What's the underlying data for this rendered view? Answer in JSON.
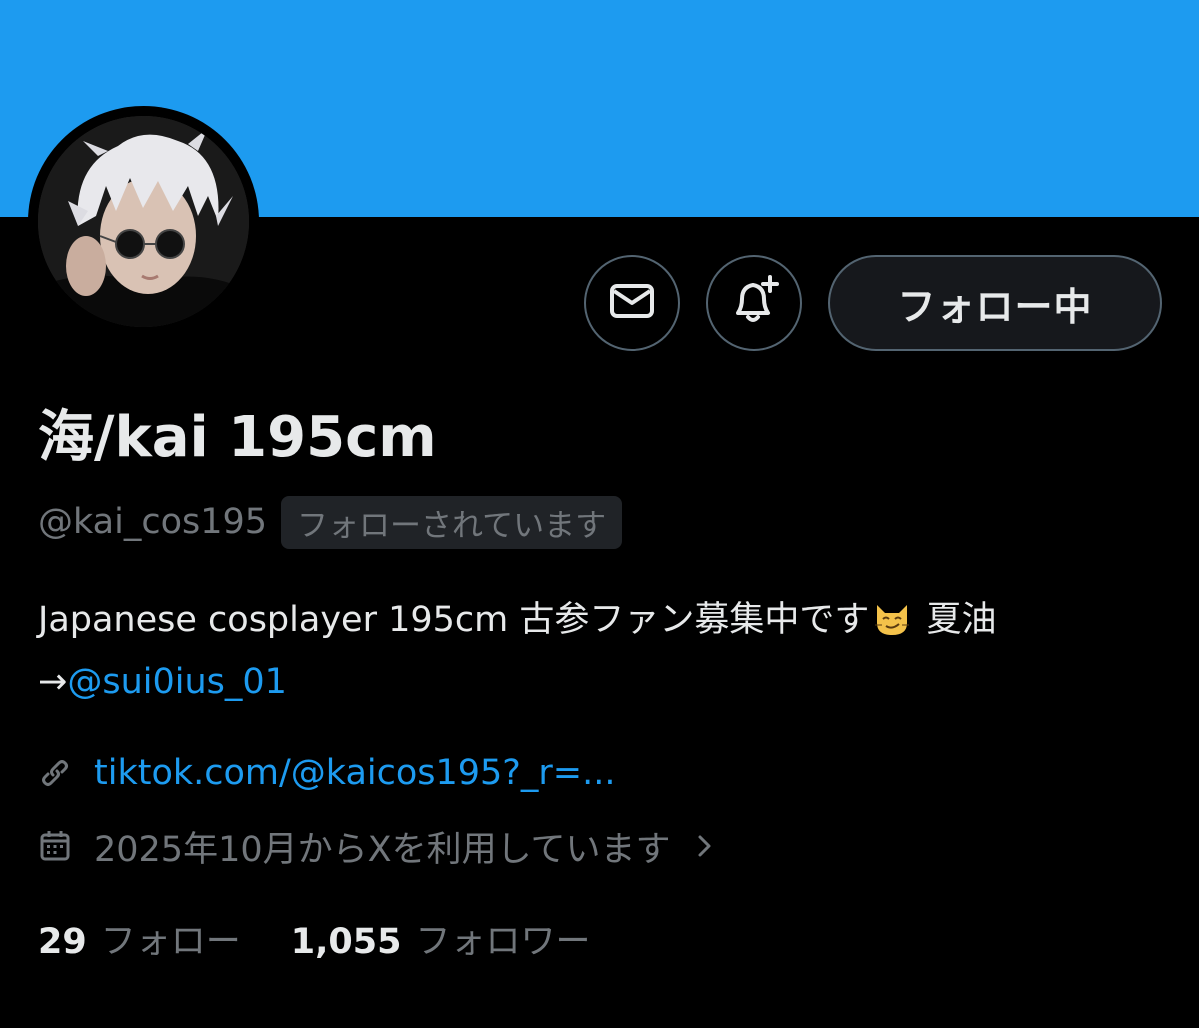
{
  "profile": {
    "display_name": "海/kai 195cm",
    "handle": "@kai_cos195",
    "follows_you_badge": "フォローされています",
    "follow_button_label": "フォロー中",
    "bio_text": "Japanese cosplayer 195cm 古参ファン募集中です",
    "bio_emoji": "cat-smirk-emoji",
    "bio_after_emoji": "夏油",
    "bio_arrow": "→",
    "bio_mention": "@sui0ius_01",
    "link": "tiktok.com/@kaicos195?_r=...",
    "joined": "2025年10月からXを利用しています",
    "following_count": "29",
    "following_label": "フォロー",
    "followers_count": "1,055",
    "followers_label": "フォロワー"
  },
  "icons": {
    "message": "envelope-icon",
    "notify": "bell-plus-icon",
    "link": "link-icon",
    "calendar": "calendar-icon",
    "chevron": "chevron-right-icon"
  },
  "colors": {
    "banner": "#1d9bf0",
    "background": "#000000",
    "text_primary": "#e7e9ea",
    "text_secondary": "#71767b",
    "accent_link": "#1d9bf0",
    "button_border": "#536471"
  }
}
